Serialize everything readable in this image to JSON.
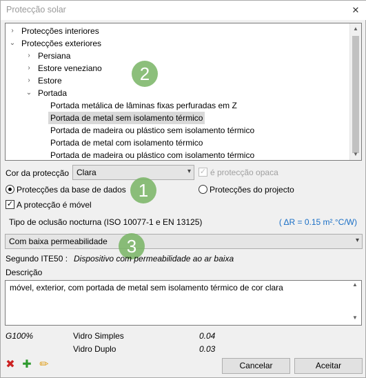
{
  "window": {
    "title": "Protecção solar",
    "close_glyph": "✕"
  },
  "tree": {
    "rows": [
      {
        "label": "Protecções interiores",
        "arrow": "›",
        "level": 0,
        "selected": false
      },
      {
        "label": "Protecções exteriores",
        "arrow": "⌄",
        "level": 0,
        "selected": false
      },
      {
        "label": "Persiana",
        "arrow": "›",
        "level": 1,
        "selected": false
      },
      {
        "label": "Estore veneziano",
        "arrow": "›",
        "level": 1,
        "selected": false
      },
      {
        "label": "Estore",
        "arrow": "›",
        "level": 1,
        "selected": false
      },
      {
        "label": "Portada",
        "arrow": "⌄",
        "level": 1,
        "selected": false
      },
      {
        "label": "Portada metálica de lâminas fixas perfuradas em Z",
        "arrow": "",
        "level": 2,
        "selected": false
      },
      {
        "label": "Portada de metal sem isolamento térmico",
        "arrow": "",
        "level": 2,
        "selected": true
      },
      {
        "label": "Portada de madeira ou plástico sem isolamento térmico",
        "arrow": "",
        "level": 2,
        "selected": false
      },
      {
        "label": "Portada de metal com isolamento térmico",
        "arrow": "",
        "level": 2,
        "selected": false
      },
      {
        "label": "Portada de madeira ou plástico com isolamento térmico",
        "arrow": "",
        "level": 2,
        "selected": false
      }
    ]
  },
  "badges": {
    "one": "1",
    "two": "2",
    "three": "3"
  },
  "color": {
    "label": "Cor da protecção",
    "value": "Clara",
    "opaque_label": "é protecção opaca",
    "opaque_checked": true
  },
  "source": {
    "database_label": "Protecções da base de dados",
    "project_label": "Protecções do projecto",
    "selected": "database"
  },
  "movable": {
    "label": "A protecção é móvel",
    "checked": true
  },
  "occlusion": {
    "label": "Tipo de oclusão nocturna (ISO 10077-1 e EN 13125)",
    "delta_r": "( ΔR = 0.15 m².°C/W)"
  },
  "permeability": {
    "value": "Com baixa permeabilidade",
    "ite_label": "Segundo ITE50 :",
    "ite_value": "Dispositivo com permeabilidade ao ar baixa"
  },
  "description": {
    "label": "Descrição",
    "text": "móvel, exterior, com portada de metal sem isolamento térmico de cor clara"
  },
  "glazing": {
    "g_label": "G100%",
    "rows": [
      {
        "name": "Vidro Simples",
        "value": "0.04"
      },
      {
        "name": "Vidro Duplo",
        "value": "0.03"
      }
    ]
  },
  "footer": {
    "cancel": "Cancelar",
    "accept": "Aceitar",
    "delete_color": "#cc2222",
    "add_color": "#2e9a2e",
    "edit_color": "#e0a020"
  }
}
